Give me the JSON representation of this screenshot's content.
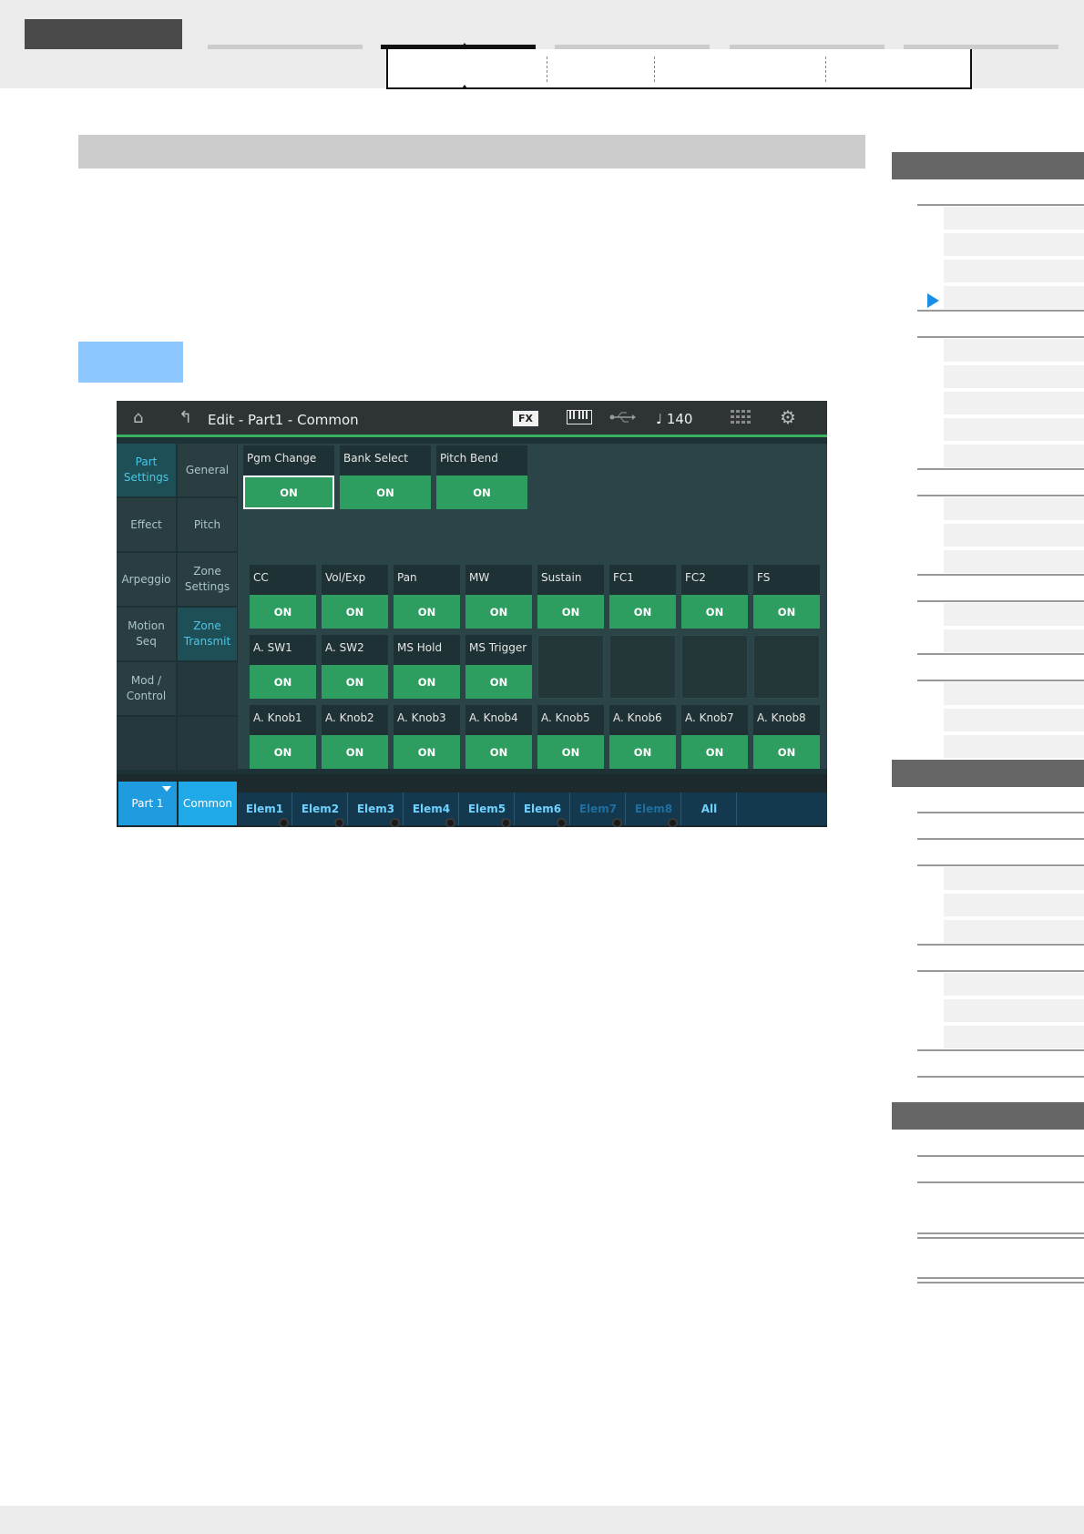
{
  "screen": {
    "title": "Edit - Part1 - Common",
    "fx_badge": "FX",
    "tempo": "♩ 140",
    "icons": [
      "home-icon",
      "back-arrow-icon",
      "keyboard-icon",
      "usb-icon",
      "grid-icon",
      "gear-icon"
    ],
    "side_nav_left": [
      {
        "label": "Part\nSettings",
        "active": true
      },
      {
        "label": "Effect",
        "active": false
      },
      {
        "label": "Arpeggio",
        "active": false
      },
      {
        "label": "Motion\nSeq",
        "active": false
      },
      {
        "label": "Mod /\nControl",
        "active": false
      },
      {
        "label": "",
        "active": false
      }
    ],
    "side_nav_right": [
      {
        "label": "General",
        "active": false
      },
      {
        "label": "Pitch",
        "active": false
      },
      {
        "label": "Zone\nSettings",
        "active": false
      },
      {
        "label": "Zone\nTransmit",
        "active": true
      },
      {
        "label": "",
        "active": false
      },
      {
        "label": "",
        "active": false
      }
    ],
    "row1": [
      {
        "label": "Pgm Change",
        "value": "ON",
        "selected": true
      },
      {
        "label": "Bank Select",
        "value": "ON",
        "selected": false
      },
      {
        "label": "Pitch Bend",
        "value": "ON",
        "selected": false
      }
    ],
    "row2": [
      {
        "label": "CC",
        "value": "ON"
      },
      {
        "label": "Vol/Exp",
        "value": "ON"
      },
      {
        "label": "Pan",
        "value": "ON"
      },
      {
        "label": "MW",
        "value": "ON"
      },
      {
        "label": "Sustain",
        "value": "ON"
      },
      {
        "label": "FC1",
        "value": "ON"
      },
      {
        "label": "FC2",
        "value": "ON"
      },
      {
        "label": "FS",
        "value": "ON"
      }
    ],
    "row3": [
      {
        "label": "A. SW1",
        "value": "ON"
      },
      {
        "label": "A. SW2",
        "value": "ON"
      },
      {
        "label": "MS Hold",
        "value": "ON"
      },
      {
        "label": "MS Trigger",
        "value": "ON"
      }
    ],
    "row4": [
      {
        "label": "A. Knob1",
        "value": "ON"
      },
      {
        "label": "A. Knob2",
        "value": "ON"
      },
      {
        "label": "A. Knob3",
        "value": "ON"
      },
      {
        "label": "A. Knob4",
        "value": "ON"
      },
      {
        "label": "A. Knob5",
        "value": "ON"
      },
      {
        "label": "A. Knob6",
        "value": "ON"
      },
      {
        "label": "A. Knob7",
        "value": "ON"
      },
      {
        "label": "A. Knob8",
        "value": "ON"
      }
    ],
    "part_button": "Part 1",
    "common_button": "Common",
    "elements": [
      {
        "label": "Elem1",
        "dim": false
      },
      {
        "label": "Elem2",
        "dim": false
      },
      {
        "label": "Elem3",
        "dim": false
      },
      {
        "label": "Elem4",
        "dim": false
      },
      {
        "label": "Elem5",
        "dim": false
      },
      {
        "label": "Elem6",
        "dim": false
      },
      {
        "label": "Elem7",
        "dim": true
      },
      {
        "label": "Elem8",
        "dim": true
      },
      {
        "label": "All",
        "dim": false
      }
    ]
  },
  "colors": {
    "accent_blue": "#1f9be0",
    "switch_green": "#2e9e60",
    "nav_arrow": "#1a8fe8"
  }
}
